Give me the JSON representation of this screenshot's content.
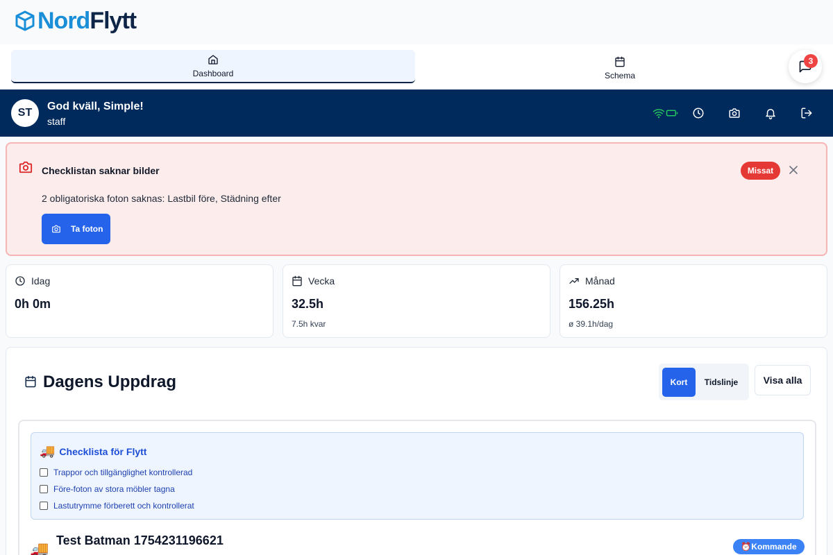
{
  "brand": {
    "part1": "Nord",
    "part2": "Flytt"
  },
  "nav": {
    "tabs": [
      {
        "label": "Dashboard",
        "icon": "home-icon",
        "active": true
      },
      {
        "label": "Schema",
        "icon": "calendar-icon",
        "active": false
      }
    ],
    "chat_badge": "3"
  },
  "user": {
    "initials": "ST",
    "greeting": "God kväll, Simple!",
    "role": "staff",
    "icons": [
      "wifi-icon",
      "battery-icon",
      "clock-icon",
      "camera-icon",
      "bell-icon",
      "logout-icon"
    ]
  },
  "alert": {
    "title": "Checklistan saknar bilder",
    "message": "2 obligatoriska foton saknas: Lastbil före, Städning efter",
    "button": "Ta foton",
    "badge": "Missat"
  },
  "stats": [
    {
      "label": "Idag",
      "value": "0h 0m",
      "sub": "",
      "icon": "clock-icon"
    },
    {
      "label": "Vecka",
      "value": "32.5h",
      "sub": "7.5h kvar",
      "icon": "calendar-icon"
    },
    {
      "label": "Månad",
      "value": "156.25h",
      "sub": "ø 39.1h/dag",
      "icon": "trending-up-icon"
    }
  ],
  "assignments": {
    "title": "Dagens Uppdrag",
    "view_kort": "Kort",
    "view_tidslinje": "Tidslinje",
    "show_all": "Visa alla",
    "checklist": {
      "title": "Checklista för Flytt",
      "items": [
        "Trappor och tillgänglighet kontrollerad",
        "Före-foton av stora möbler tagna",
        "Lastutrymme förberett och kontrollerat"
      ]
    },
    "job": {
      "title": "Test Batman 1754231196621",
      "status": "Kommande"
    }
  },
  "colors": {
    "navy": "#002a5c",
    "accent": "#2563eb",
    "danger": "#e53935",
    "nord": "#1a8fd8"
  }
}
